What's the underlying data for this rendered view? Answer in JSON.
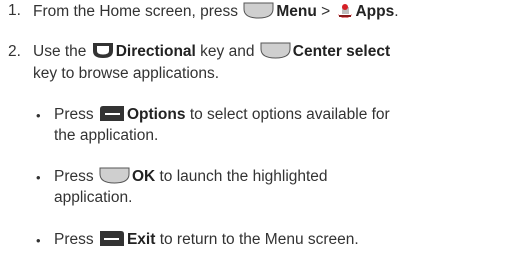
{
  "steps": [
    {
      "number": "1.",
      "text_a": "From the Home screen, press",
      "key_menu": "Menu",
      "sep": ">",
      "key_apps": "Apps",
      "end": "."
    },
    {
      "number": "2.",
      "text_a": "Use the",
      "key_dir": "Directional",
      "text_b": "key and",
      "key_center": "Center select",
      "text_c": "key to browse applications."
    }
  ],
  "bullets": [
    {
      "mark": "•",
      "press": "Press",
      "key": "Options",
      "text_1": "to select options available for",
      "text_2": "the application."
    },
    {
      "mark": "•",
      "press": "Press",
      "key": "OK",
      "text_1": "to launch the highlighted",
      "text_2": "application."
    },
    {
      "mark": "•",
      "press": "Press",
      "key": "Exit",
      "text_1": "to return to the Menu screen."
    }
  ],
  "icons": {
    "menu": "center-key-icon",
    "apps": "apps-icon",
    "directional": "directional-key-icon",
    "center": "center-key-icon",
    "options": "left-softkey-icon",
    "ok": "center-key-icon",
    "exit": "right-softkey-icon"
  },
  "colors": {
    "text": "#333333",
    "key_fill": "#cfcfcf",
    "key_dark": "#333333",
    "apps_accent": "#d61f26"
  }
}
